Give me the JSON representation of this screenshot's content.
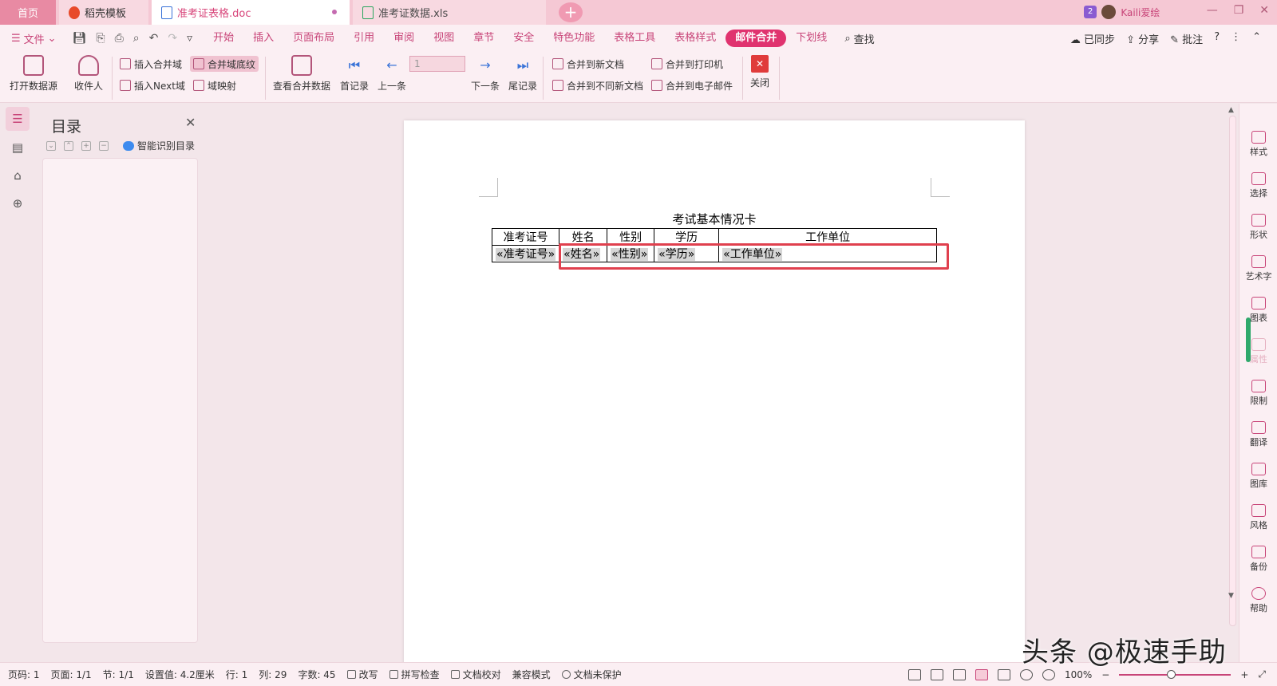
{
  "tabs": [
    {
      "label": "首页"
    },
    {
      "label": "稻壳模板"
    },
    {
      "label": "准考证表格.doc"
    },
    {
      "label": "准考证数据.xls"
    }
  ],
  "user": {
    "badge": "2",
    "name": "Kaili爱绘"
  },
  "menu": {
    "file": "文件",
    "tabs": [
      "开始",
      "插入",
      "页面布局",
      "引用",
      "审阅",
      "视图",
      "章节",
      "安全",
      "特色功能",
      "表格工具",
      "表格样式",
      "邮件合并",
      "下划线"
    ],
    "active_tab": "邮件合并",
    "search": "查找",
    "sync": "已同步",
    "share": "分享",
    "comment": "批注"
  },
  "ribbon": {
    "open_source": "打开数据源",
    "recipient": "收件人",
    "insert_field": "插入合并域",
    "field_shading": "合并域底纹",
    "insert_next": "插入Next域",
    "field_map": "域映射",
    "view_merged": "查看合并数据",
    "first": "首记录",
    "prev": "上一条",
    "record_value": "1",
    "next": "下一条",
    "last": "尾记录",
    "merge_new_doc": "合并到新文档",
    "merge_diff_doc": "合并到不同新文档",
    "merge_printer": "合并到打印机",
    "merge_email": "合并到电子邮件",
    "close": "关闭"
  },
  "outline": {
    "title": "目录",
    "smart": "智能识别目录"
  },
  "document": {
    "title": "考试基本情况卡",
    "headers": [
      "准考证号",
      "姓名",
      "性别",
      "学历",
      "工作单位"
    ],
    "fields": [
      "«准考证号»",
      "«姓名»",
      "«性别»",
      "«学历»",
      "«工作单位»"
    ]
  },
  "right_sidebar": [
    "样式",
    "选择",
    "形状",
    "艺术字",
    "图表",
    "属性",
    "限制",
    "翻译",
    "图库",
    "风格",
    "备份",
    "帮助"
  ],
  "status": {
    "page_num": "页码: 1",
    "pages": "页面: 1/1",
    "section": "节: 1/1",
    "setting": "设置值: 4.2厘米",
    "row": "行: 1",
    "col": "列: 29",
    "words": "字数: 45",
    "revise": "改写",
    "spell": "拼写检查",
    "proof": "文档校对",
    "compat": "兼容模式",
    "protect": "文档未保护",
    "zoom": "100%"
  },
  "watermark": "头条 @极速手助",
  "colors": {
    "accent": "#e0336f",
    "highlight_box": "#e0404e"
  }
}
